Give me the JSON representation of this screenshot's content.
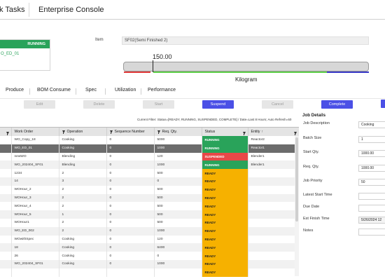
{
  "topbar": {
    "tab1": "k Tasks",
    "tab2": "Enterprise Console"
  },
  "workcard": {
    "status": "RUNNING",
    "name": "O_ED_01"
  },
  "item": {
    "label": "Item",
    "value": "SF02(Semi Finished 2)"
  },
  "quantity": {
    "value": "150.00",
    "unit": "Kilogram"
  },
  "subtabs": [
    "Produce",
    "BOM Consume",
    "Spec",
    "Utilization",
    "Performance"
  ],
  "buttons": {
    "edit": "Edit",
    "delete": "Delete",
    "start": "Start",
    "suspend": "Suspend",
    "cancel": "Cancel",
    "complete": "Complete"
  },
  "filter_text": "Current Filter: Status=[READY, RUNNING, SUSPENDED, COMPLETE] / Date=Last 8 Hours; Auto Refresh=60",
  "grid": {
    "headers": {
      "work_order": "Work Order",
      "operation": "Operation",
      "sequence": "Sequence Number",
      "req_qty": "Req. Qty.",
      "status": "Status",
      "entity": "Entity"
    },
    "rows": [
      {
        "wo": "WO_Copy_18",
        "op": "Cooking",
        "seq": "0",
        "qty": "5000",
        "status": "RUNNING",
        "entity": "Reactor2"
      },
      {
        "wo": "WO_ED_01",
        "op": "Cooking",
        "seq": "0",
        "qty": "1000",
        "status": "RUNNING",
        "entity": "Reactor1"
      },
      {
        "wo": "newWO",
        "op": "Blending",
        "seq": "0",
        "qty": "120",
        "status": "SUSPENDED",
        "entity": "Blender1"
      },
      {
        "wo": "WO_202404_SF01",
        "op": "Blending",
        "seq": "0",
        "qty": "1000",
        "status": "RUNNING",
        "entity": "Blender1"
      },
      {
        "wo": "1234",
        "op": "2",
        "seq": "0",
        "qty": "500",
        "status": "READY",
        "entity": ""
      },
      {
        "wo": "14",
        "op": "3",
        "seq": "0",
        "qty": "0",
        "status": "READY",
        "entity": ""
      },
      {
        "wo": "WOHour_2",
        "op": "2",
        "seq": "0",
        "qty": "500",
        "status": "READY",
        "entity": ""
      },
      {
        "wo": "WOHour_3",
        "op": "2",
        "seq": "0",
        "qty": "500",
        "status": "READY",
        "entity": ""
      },
      {
        "wo": "WOHour_4",
        "op": "2",
        "seq": "0",
        "qty": "500",
        "status": "READY",
        "entity": ""
      },
      {
        "wo": "WOHour_5",
        "op": "1",
        "seq": "0",
        "qty": "500",
        "status": "READY",
        "entity": ""
      },
      {
        "wo": "WOHour1",
        "op": "2",
        "seq": "0",
        "qty": "500",
        "status": "READY",
        "entity": ""
      },
      {
        "wo": "WO_ED_002",
        "op": "2",
        "seq": "0",
        "qty": "1000",
        "status": "READY",
        "entity": ""
      },
      {
        "wo": "WOwithSpec",
        "op": "Cooking",
        "seq": "0",
        "qty": "120",
        "status": "READY",
        "entity": ""
      },
      {
        "wo": "18",
        "op": "Cooking",
        "seq": "0",
        "qty": "6400",
        "status": "READY",
        "entity": ""
      },
      {
        "wo": "26",
        "op": "Cooking",
        "seq": "0",
        "qty": "0",
        "status": "READY",
        "entity": ""
      },
      {
        "wo": "WO_202404_SF01",
        "op": "Cooking",
        "seq": "0",
        "qty": "1000",
        "status": "READY",
        "entity": ""
      },
      {
        "wo": "",
        "op": "",
        "seq": "",
        "qty": "",
        "status": "READY",
        "entity": ""
      }
    ]
  },
  "details": {
    "title": "Job Details",
    "job_description_label": "Job Description",
    "job_description_value": "Cooking",
    "batch_size_label": "Batch Size",
    "batch_size_value": "1",
    "start_qty_label": "Start Qty.",
    "start_qty_value": "1000.00",
    "req_qty_label": "Req. Qty.",
    "req_qty_value": "1000.00",
    "priority_label": "Job Priority",
    "priority_value": "50",
    "latest_start_label": "Latest Start Time",
    "due_date_label": "Due Date",
    "est_finish_label": "Est Finish Time",
    "est_finish_value": "5/26/2024 12",
    "notes_label": "Notes"
  },
  "colors": {
    "running": "#29a35a",
    "suspended": "#e84848",
    "ready": "#f6b100",
    "primary": "#4b50e6"
  }
}
